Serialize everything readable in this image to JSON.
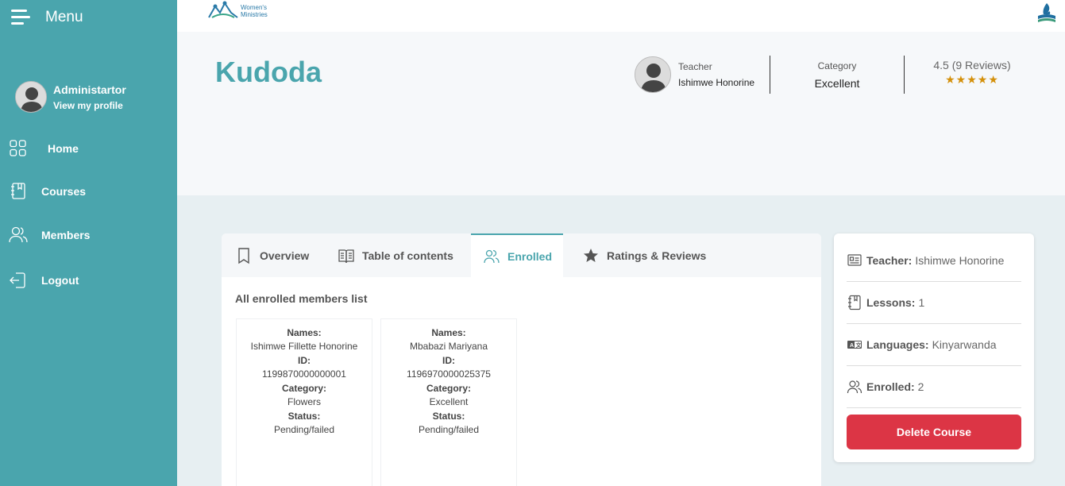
{
  "sidebar": {
    "menu_label": "Menu",
    "profile": {
      "name": "Administartor",
      "link": "View my profile"
    },
    "items": [
      {
        "label": "Home",
        "icon": "grid-icon"
      },
      {
        "label": "Courses",
        "icon": "notebook-icon"
      },
      {
        "label": "Members",
        "icon": "users-icon"
      },
      {
        "label": "Logout",
        "icon": "logout-icon"
      }
    ]
  },
  "topbar": {
    "logo_left_text_1": "Women's",
    "logo_left_text_2": "Ministries"
  },
  "course": {
    "title": "Kudoda",
    "teacher_label": "Teacher",
    "teacher_name": "Ishimwe Honorine",
    "category_label": "Category",
    "category_value": "Excellent",
    "rating_text": "4.5 (9 Reviews)",
    "rating_value": 4.5,
    "stars": "★★★★★"
  },
  "tabs": [
    {
      "label": "Overview",
      "icon": "bookmark-icon"
    },
    {
      "label": "Table of contents",
      "icon": "book-open-icon"
    },
    {
      "label": "Enrolled",
      "icon": "users-icon",
      "active": true
    },
    {
      "label": "Ratings & Reviews",
      "icon": "star-icon"
    }
  ],
  "enrolled": {
    "title": "All enrolled members list",
    "labels": {
      "names": "Names:",
      "id": "ID:",
      "category": "Category:",
      "status": "Status:"
    },
    "members": [
      {
        "name": "Ishimwe Fillette Honorine",
        "id": "1199870000000001",
        "category": "Flowers",
        "status": "Pending/failed"
      },
      {
        "name": "Mbabazi Mariyana",
        "id": "1196970000025375",
        "category": "Excellent",
        "status": "Pending/failed"
      }
    ]
  },
  "info": {
    "teacher_label": "Teacher:",
    "teacher_value": "Ishimwe Honorine",
    "lessons_label": "Lessons:",
    "lessons_value": "1",
    "languages_label": "Languages:",
    "languages_value": "Kinyarwanda",
    "enrolled_label": "Enrolled:",
    "enrolled_value": "2",
    "delete_label": "Delete Course"
  },
  "colors": {
    "accent": "#4aa5ad",
    "danger": "#dc3545",
    "star": "#d4900a"
  }
}
